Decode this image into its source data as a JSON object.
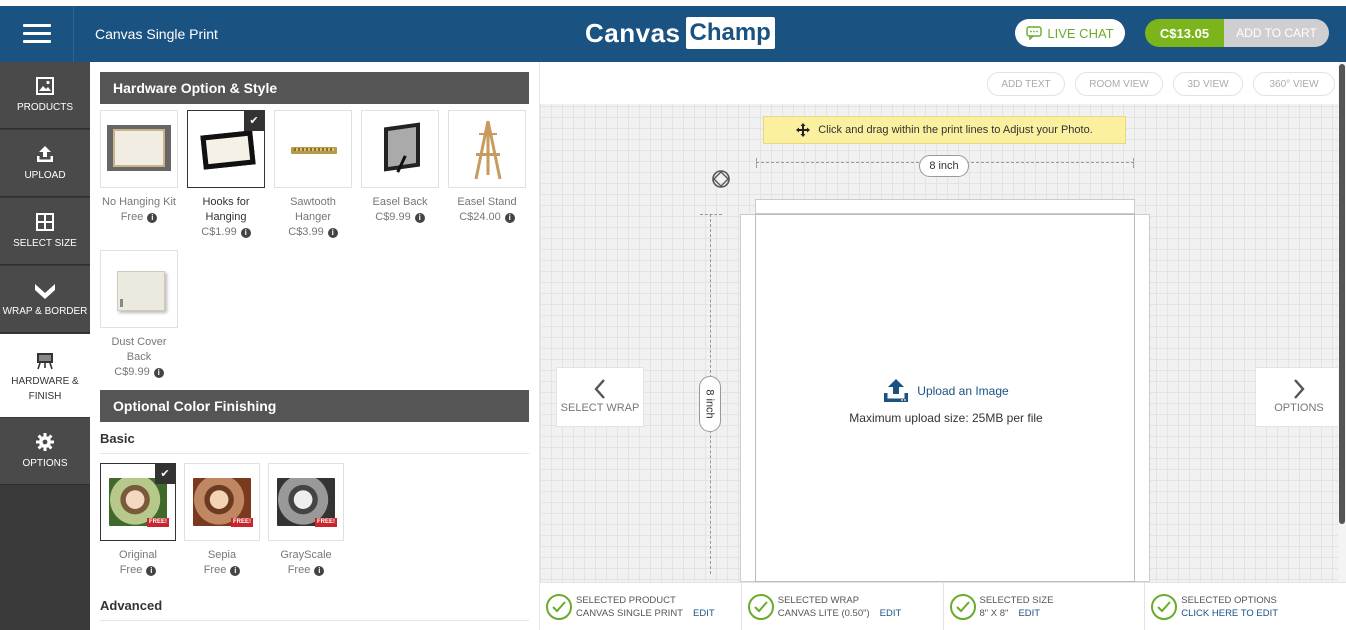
{
  "header": {
    "page_title": "Canvas Single Print",
    "logo_part1": "Canvas",
    "logo_part2": "Champ",
    "live_chat": "LIVE CHAT",
    "price": "C$13.05",
    "add_to_cart": "ADD TO CART"
  },
  "sidebar": {
    "items": [
      {
        "label": "PRODUCTS",
        "icon": "image-icon"
      },
      {
        "label": "UPLOAD",
        "icon": "upload-icon"
      },
      {
        "label": "SELECT SIZE",
        "icon": "grid-icon"
      },
      {
        "label": "WRAP & BORDER",
        "icon": "wrap-icon"
      },
      {
        "label": "HARDWARE &",
        "label2": "FINISH",
        "icon": "easel-icon",
        "active": true
      },
      {
        "label": "OPTIONS",
        "icon": "gear-icon"
      }
    ]
  },
  "panel": {
    "hardware_heading": "Hardware Option & Style",
    "hardware": [
      {
        "name1": "No Hanging Kit",
        "name2": "",
        "price": "Free"
      },
      {
        "name1": "Hooks for",
        "name2": "Hanging",
        "price": "C$1.99",
        "selected": true
      },
      {
        "name1": "Sawtooth",
        "name2": "Hanger",
        "price": "C$3.99"
      },
      {
        "name1": "Easel Back",
        "name2": "",
        "price": "C$9.99"
      },
      {
        "name1": "Easel Stand",
        "name2": "",
        "price": "C$24.00"
      },
      {
        "name1": "Dust Cover",
        "name2": "Back",
        "price": "C$9.99"
      }
    ],
    "color_heading": "Optional Color Finishing",
    "basic_label": "Basic",
    "advanced_label": "Advanced",
    "finishes": [
      {
        "name": "Original",
        "price": "Free",
        "badge": "FREE!",
        "selected": true
      },
      {
        "name": "Sepia",
        "price": "Free",
        "badge": "FREE!"
      },
      {
        "name": "GrayScale",
        "price": "Free",
        "badge": "FREE!"
      }
    ]
  },
  "workspace": {
    "toolbar": [
      "ADD TEXT",
      "ROOM VIEW",
      "3D VIEW",
      "360° VIEW"
    ],
    "hint": "Click and drag within the print lines to Adjust your Photo.",
    "width_label": "8 inch",
    "height_label": "8 inch",
    "upload_link": "Upload an Image",
    "upload_note": "Maximum upload size: 25MB per file",
    "prev_label": "SELECT WRAP",
    "next_label": "OPTIONS"
  },
  "summary": [
    {
      "title": "SELECTED PRODUCT",
      "value": "CANVAS SINGLE PRINT",
      "edit": "EDIT"
    },
    {
      "title": "SELECTED WRAP",
      "value": "CANVAS LITE (0.50\")",
      "edit": "EDIT"
    },
    {
      "title": "SELECTED SIZE",
      "value": "8\" X 8\"",
      "edit": "EDIT"
    },
    {
      "title": "SELECTED OPTIONS",
      "value": "CLICK HERE TO EDIT",
      "edit": ""
    }
  ],
  "colors": {
    "header_blue": "#1a5282",
    "accent_green": "#7bb51b",
    "sidebar_dark": "#4a4a4a",
    "badge_red": "#c8252c"
  }
}
